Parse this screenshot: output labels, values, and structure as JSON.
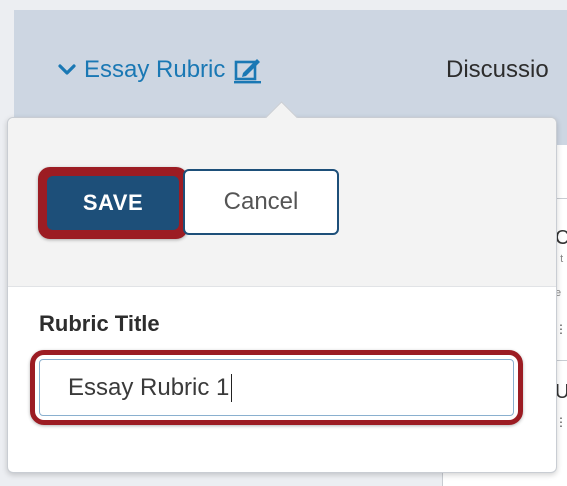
{
  "header": {
    "rubric_toggle_label": "Essay Rubric",
    "discussion_tab_label": "Discussio"
  },
  "background_panel": {
    "row1_letter": "C",
    "row1_small_a": "' t",
    "row1_small_b": "e",
    "row2_letter": "U",
    "dots": "⋮⋮"
  },
  "popover": {
    "save_label": "SAVE",
    "cancel_label": "Cancel",
    "rubric_title_label": "Rubric Title",
    "rubric_title_value": "Essay Rubric 1"
  },
  "colors": {
    "link_blue": "#1a78b4",
    "save_blue": "#1d4f79",
    "highlight_red": "#9c1c23"
  },
  "icons": {
    "chevron": "chevron-down-icon",
    "edit": "edit-icon"
  }
}
